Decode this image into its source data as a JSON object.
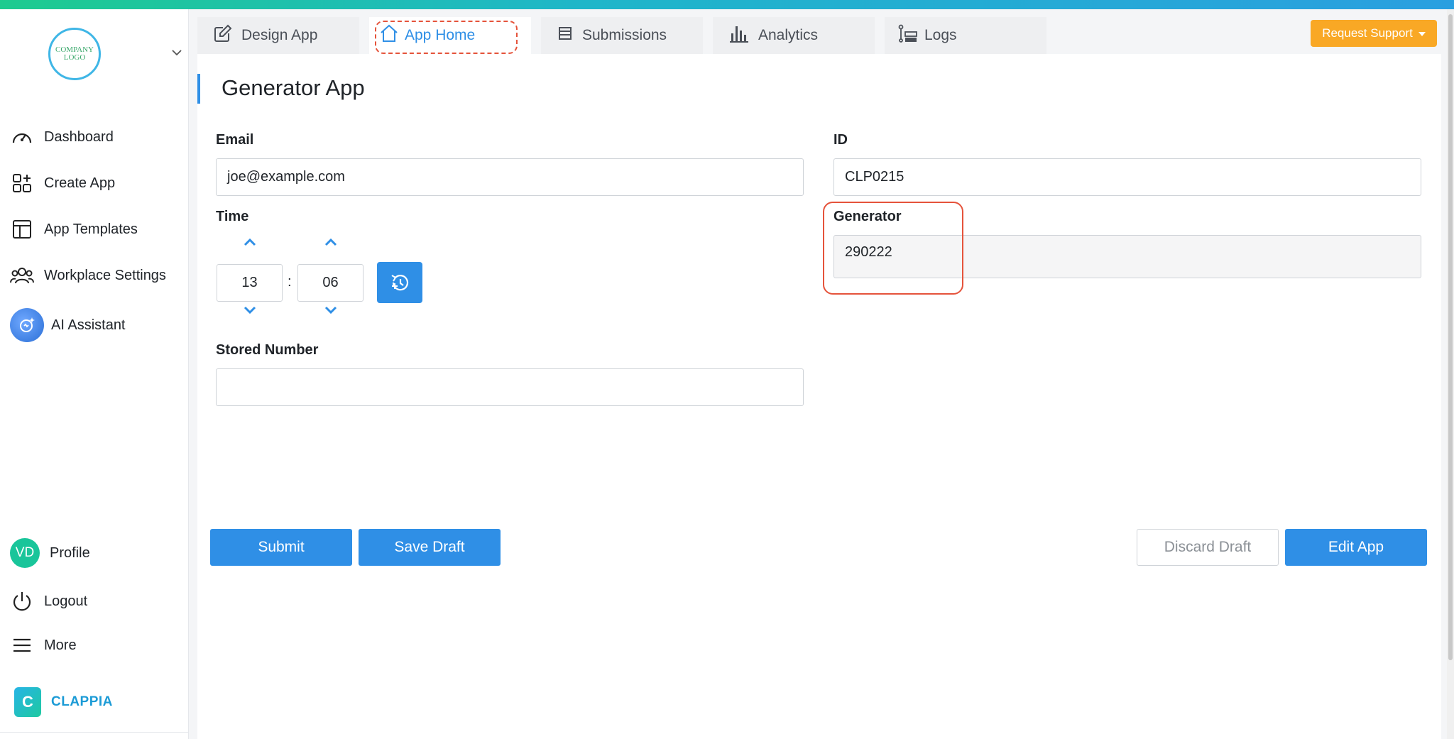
{
  "logo": {
    "text": "COMPANY LOGO"
  },
  "sidebar": {
    "items": [
      {
        "label": "Dashboard",
        "icon": "gauge-icon"
      },
      {
        "label": "Create App",
        "icon": "grid-plus-icon"
      },
      {
        "label": "App Templates",
        "icon": "layout-icon"
      },
      {
        "label": "Workplace Settings",
        "icon": "users-icon"
      },
      {
        "label": "AI Assistant",
        "icon": "ai-assistant-icon"
      },
      {
        "label": "Profile",
        "icon": "avatar"
      },
      {
        "label": "Logout",
        "icon": "power-icon"
      },
      {
        "label": "More",
        "icon": "menu-icon"
      }
    ],
    "avatar_initials": "VD",
    "brand": "CLAPPIA"
  },
  "tabs": [
    {
      "label": "Design App",
      "icon": "edit-icon"
    },
    {
      "label": "App Home",
      "icon": "home-icon",
      "active": true
    },
    {
      "label": "Submissions",
      "icon": "list-icon"
    },
    {
      "label": "Analytics",
      "icon": "bar-chart-icon"
    },
    {
      "label": "Logs",
      "icon": "logs-icon"
    }
  ],
  "support": {
    "label": "Request Support"
  },
  "page": {
    "title": "Generator App"
  },
  "form": {
    "email": {
      "label": "Email",
      "value": "joe@example.com"
    },
    "id": {
      "label": "ID",
      "value": "CLP0215"
    },
    "time": {
      "label": "Time",
      "hours": "13",
      "minutes": "06",
      "separator": ":"
    },
    "generator": {
      "label": "Generator",
      "value": "290222"
    },
    "stored_number": {
      "label": "Stored Number",
      "value": ""
    }
  },
  "actions": {
    "submit": "Submit",
    "save_draft": "Save Draft",
    "discard_draft": "Discard Draft",
    "edit_app": "Edit App"
  },
  "colors": {
    "accent": "#2f8fe6",
    "support": "#f9a825",
    "highlight": "#e5533b",
    "avatar": "#19c59a"
  }
}
